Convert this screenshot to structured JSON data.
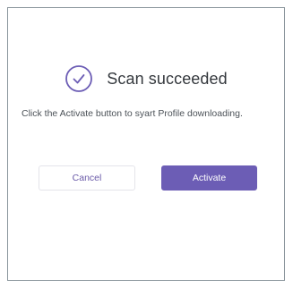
{
  "dialog": {
    "title": "Scan succeeded",
    "icon": "check-circle-icon",
    "message": "Click the Activate button to syart Profile downloading.",
    "cancel_label": "Cancel",
    "activate_label": "Activate"
  },
  "colors": {
    "accent": "#6c5db5",
    "title_text": "#35393e",
    "body_text": "#4c5258",
    "border": "#8a959c"
  }
}
